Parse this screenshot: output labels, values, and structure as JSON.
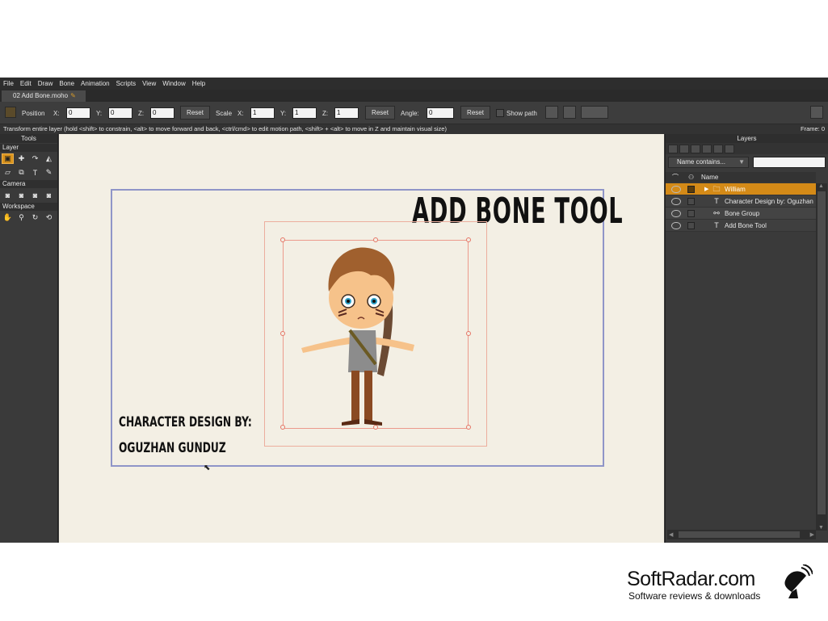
{
  "menu": [
    "File",
    "Edit",
    "Draw",
    "Bone",
    "Animation",
    "Scripts",
    "View",
    "Window",
    "Help"
  ],
  "document_tab": {
    "title": "02 Add Bone.moho"
  },
  "toolbar": {
    "position_label": "Position",
    "x_label": "X:",
    "x_value": "0",
    "y_label": "Y:",
    "y_value": "0",
    "z_label": "Z:",
    "z_value": "0",
    "reset1": "Reset",
    "scale_label": "Scale",
    "sx_label": "X:",
    "sx_value": "1",
    "sy_label": "Y:",
    "sy_value": "1",
    "sz_label": "Z:",
    "sz_value": "1",
    "reset2": "Reset",
    "angle_label": "Angle:",
    "angle_value": "0",
    "reset3": "Reset",
    "show_path_label": "Show path"
  },
  "status": {
    "message": "Transform entire layer (hold <shift> to constrain, <alt> to move forward and back, <ctrl/cmd> to edit motion path, <shift> + <alt> to move in Z and maintain visual size)",
    "frame": "Frame: 0"
  },
  "tools_panel": {
    "title": "Tools",
    "layer_section": "Layer",
    "camera_section": "Camera",
    "workspace_section": "Workspace"
  },
  "canvas": {
    "heading": "ADD BONE TOOL",
    "credit_line1": "CHARACTER DESIGN BY:",
    "credit_line2": "OGUZHAN GUNDUZ"
  },
  "layers_panel": {
    "title": "Layers",
    "filter_label": "Name contains...",
    "column_name": "Name",
    "layers": [
      {
        "name": "William",
        "type": "folder-icon",
        "selected": true
      },
      {
        "name": "Character Design by: Oguzhan",
        "type": "text-icon",
        "selected": false
      },
      {
        "name": "Bone Group",
        "type": "bone-icon",
        "selected": false
      },
      {
        "name": "Add Bone Tool",
        "type": "text-icon",
        "selected": false
      }
    ]
  },
  "watermark": {
    "title": "SoftRadar.com",
    "subtitle": "Software reviews & downloads"
  },
  "colors": {
    "accent": "#d48a17",
    "canvas_bg": "#f3efe4",
    "stage_border": "#8f95c8",
    "bounds": "#ec9a8c"
  }
}
